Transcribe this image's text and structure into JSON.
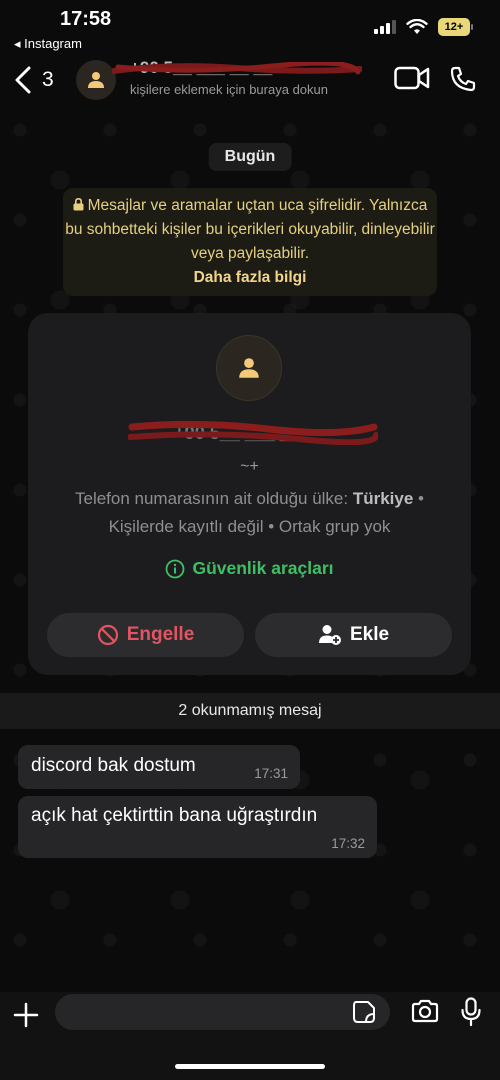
{
  "status": {
    "time": "17:58",
    "back_app": "◂ Instagram",
    "battery": "12+"
  },
  "header": {
    "back_count": "3",
    "contact_name": "+90 5__ ___ __ __",
    "subtitle": "kişilere eklemek için buraya dokun"
  },
  "chat": {
    "date_chip": "Bugün",
    "encryption_notice": "Mesajlar ve aramalar uçtan uca şifrelidir. Yalnızca bu sohbetteki kişiler bu içerikleri okuyabilir, dinleyebilir veya paylaşabilir.",
    "learn_more": "Daha fazla bilgi"
  },
  "card": {
    "phone": "+90 5__ ___ __ __",
    "username": "~+",
    "country_label": "Telefon numarasının ait olduğu ülke:",
    "country": "Türkiye",
    "info_line2": "Kişilerde kayıtlı değil • Ortak grup yok",
    "security_tools": "Güvenlik araçları",
    "block_label": "Engelle",
    "add_label": "Ekle"
  },
  "unread": "2 okunmamış mesaj",
  "messages": [
    {
      "text": "discord bak dostum",
      "time": "17:31"
    },
    {
      "text": "açık hat çektirttin bana uğraştırdın",
      "time": "17:32"
    }
  ],
  "composer": {
    "placeholder": ""
  },
  "colors": {
    "accent_green": "#3fbf64",
    "block_red": "#e05561",
    "notice_yellow": "#e6cf80"
  }
}
